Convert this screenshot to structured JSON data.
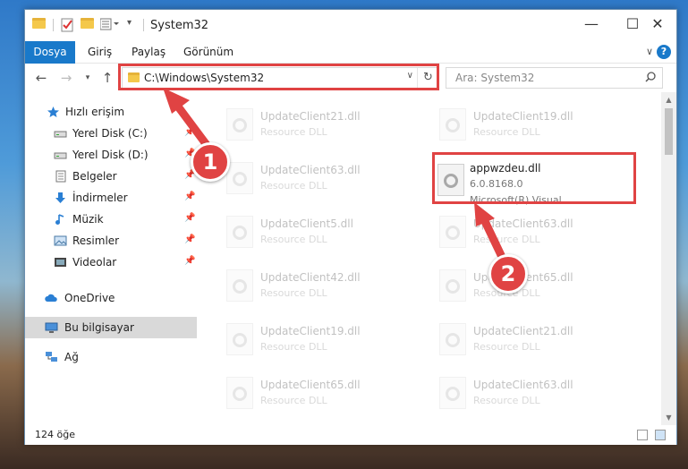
{
  "window": {
    "title": "System32",
    "controls": {
      "minimize": "—",
      "maximize": "☐",
      "close": "✕"
    }
  },
  "ribbon": {
    "tabs": [
      "Dosya",
      "Giriş",
      "Paylaş",
      "Görünüm"
    ]
  },
  "nav": {
    "address": "C:\\Windows\\System32",
    "search_placeholder": "Ara: System32"
  },
  "sidebar": {
    "items": [
      {
        "label": "Hızlı erişim",
        "icon": "star-icon",
        "pinned": false
      },
      {
        "label": "Yerel Disk (C:)",
        "icon": "drive-icon",
        "pinned": true
      },
      {
        "label": "Yerel Disk (D:)",
        "icon": "drive-icon",
        "pinned": true
      },
      {
        "label": "Belgeler",
        "icon": "document-icon",
        "pinned": true
      },
      {
        "label": "İndirmeler",
        "icon": "download-icon",
        "pinned": true
      },
      {
        "label": "Müzik",
        "icon": "music-icon",
        "pinned": true
      },
      {
        "label": "Resimler",
        "icon": "pictures-icon",
        "pinned": true
      },
      {
        "label": "Videolar",
        "icon": "video-icon",
        "pinned": true
      },
      {
        "label": "OneDrive",
        "icon": "cloud-icon",
        "pinned": false
      },
      {
        "label": "Bu bilgisayar",
        "icon": "computer-icon",
        "pinned": false,
        "selected": true
      },
      {
        "label": "Ağ",
        "icon": "network-icon",
        "pinned": false
      }
    ]
  },
  "files": {
    "left": [
      {
        "name": "UpdateClient21.dll",
        "desc": "Resource DLL"
      },
      {
        "name": "UpdateClient63.dll",
        "desc": "Resource DLL"
      },
      {
        "name": "UpdateClient5.dll",
        "desc": "Resource DLL"
      },
      {
        "name": "UpdateClient42.dll",
        "desc": "Resource DLL"
      },
      {
        "name": "UpdateClient19.dll",
        "desc": "Resource DLL"
      },
      {
        "name": "UpdateClient65.dll",
        "desc": "Resource DLL"
      }
    ],
    "right": [
      {
        "name": "UpdateClient19.dll",
        "desc": "Resource DLL"
      },
      {
        "name": "UpdateClient63.dll",
        "desc": "Resource DLL"
      },
      {
        "name": "UpdateClient65.dll",
        "desc": "Resource DLL"
      },
      {
        "name": "UpdateClient21.dll",
        "desc": "Resource DLL"
      },
      {
        "name": "UpdateClient63.dll",
        "desc": "Resource DLL"
      }
    ],
    "highlighted": {
      "name": "appwzdeu.dll",
      "version": "6.0.8168.0",
      "desc": "Microsoft(R) Visual..."
    }
  },
  "status": {
    "count": "124 öğe"
  },
  "annotations": {
    "step1": "1",
    "step2": "2",
    "color": "#e04343"
  },
  "colors": {
    "accent": "#1979ca",
    "folder": "#f4c84b"
  }
}
